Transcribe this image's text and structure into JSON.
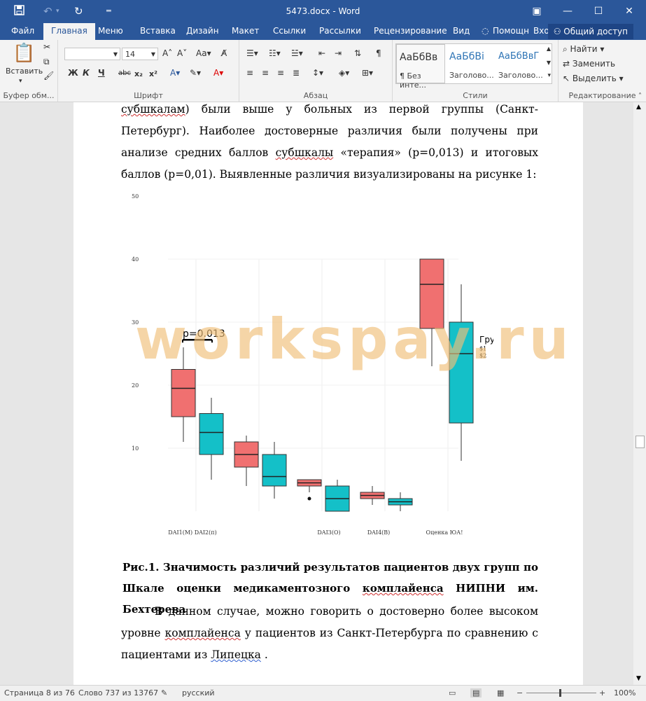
{
  "window": {
    "title": "5473.docx - Word",
    "min_glyph": "—",
    "max_glyph": "☐",
    "close_glyph": "✕",
    "ribbon_opts_glyph": "▣"
  },
  "tabs": [
    "Файл",
    "Главная",
    "Меню",
    "Вставка",
    "Дизайн",
    "Макет",
    "Ссылки",
    "Рассылки",
    "Рецензирование",
    "Вид"
  ],
  "tell_me": "Помощн",
  "sign_in": "Вход",
  "share": "Общий доступ",
  "ribbon": {
    "paste_label": "Вставить",
    "clipboard_label": "Буфер обм...",
    "font_name": "",
    "font_size": "14",
    "font_label": "Шрифт",
    "paragraph_label": "Абзац",
    "styles_label": "Стили",
    "editing_label": "Редактирование",
    "bold": "Ж",
    "italic": "К",
    "underline": "Ч",
    "strike": "abc",
    "subscript": "x₂",
    "superscript": "x²",
    "styles": [
      {
        "sample": "АаБбВв",
        "name": "¶ Без инте..."
      },
      {
        "sample": "АаБбВі",
        "name": "Заголово..."
      },
      {
        "sample": "АаБбВвГ",
        "name": "Заголово..."
      }
    ],
    "find": "Найти",
    "replace": "Заменить",
    "select": "Выделить"
  },
  "document": {
    "para1_sq1": "субшкалам",
    "para1_after_sq1": ") были выше у больных из первой группы (Санкт- Петербург). Наиболее достоверные различия были получены при анализе средних баллов ",
    "para1_sq2": "субшкалы",
    "para1_rest": " «терапия» (р=0,013) и итоговых баллов (р=0,01). Выявленные различия визуализированы на рисунке 1:",
    "caption_part1": "Рис.1. Значимость различий результатов пациентов двух групп по Шкале оценки медикаментозного ",
    "caption_sq": "комплайенса",
    "caption_part2": " НИПНИ им. Бехтерева",
    "para2_part1": "В данном случае, можно говорить о достоверно более высоком уровне ",
    "para2_sq1": "комплайенса",
    "para2_part2": " у пациентов из Санкт-Петербурга по сравнению с пациентами из ",
    "para2_sq2": "Липецка",
    "para2_part3": " .",
    "watermark": "workspay.ru"
  },
  "chart_data": {
    "type": "box",
    "ylim": [
      0,
      50
    ],
    "y_ticks": [
      10,
      20,
      30,
      40,
      50
    ],
    "x_labels": [
      "DAI1(M) DAI2(п)",
      "DAI3(O)",
      "DAI4(B)",
      "Оценка ЮА!"
    ],
    "annotation": "p=0.013",
    "legend_title": "Группа",
    "legend_items": [
      "$1",
      "$2"
    ],
    "colors": {
      "group1": "#f07070",
      "group2": "#14c0c8"
    },
    "boxes": [
      {
        "group": 1,
        "min": 11,
        "q1": 15,
        "median": 19.5,
        "q3": 22.5,
        "max": 26
      },
      {
        "group": 2,
        "min": 5,
        "q1": 9,
        "median": 12.5,
        "q3": 15.5,
        "max": 18
      },
      {
        "group": 1,
        "min": 4,
        "q1": 7,
        "median": 9,
        "q3": 11,
        "max": 12
      },
      {
        "group": 2,
        "min": 2,
        "q1": 4,
        "median": 5.5,
        "q3": 9,
        "max": 11
      },
      {
        "group": 1,
        "min": 3,
        "q1": 4,
        "median": 4.5,
        "q3": 5,
        "max": 5,
        "outliers": [
          2
        ]
      },
      {
        "group": 2,
        "min": 0,
        "q1": 0,
        "median": 2,
        "q3": 4,
        "max": 5
      },
      {
        "group": 1,
        "min": 1,
        "q1": 2,
        "median": 2.5,
        "q3": 3,
        "max": 4
      },
      {
        "group": 2,
        "min": 0,
        "q1": 1,
        "median": 1.5,
        "q3": 2,
        "max": 3
      },
      {
        "group": 1,
        "min": 23,
        "q1": 29,
        "median": 36,
        "q3": 40,
        "max": 40
      },
      {
        "group": 2,
        "min": 8,
        "q1": 14,
        "median": 25,
        "q3": 30,
        "max": 36
      }
    ]
  },
  "status": {
    "page": "Страница 8 из 76",
    "words": "Слово 737 из 13767",
    "lang": "русский",
    "zoom": "100%"
  }
}
